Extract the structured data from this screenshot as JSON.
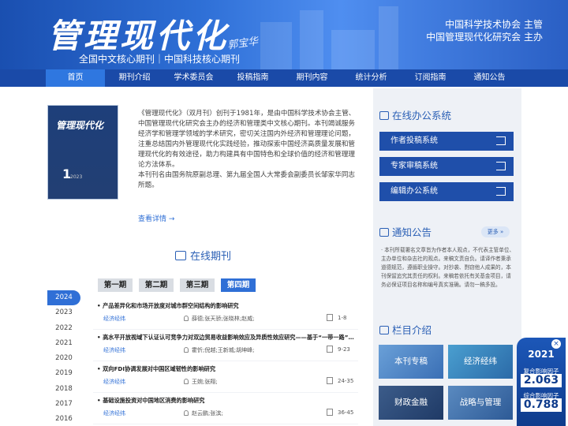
{
  "header": {
    "title": "管理现代化",
    "signature": "郭宝华",
    "subtitle": "全国中文核心期刊｜中国科技核心期刊",
    "org_line1": "中国科学技术协会 主管",
    "org_line2": "中国管理现代化研究会 主办"
  },
  "nav": {
    "items": [
      {
        "label": "首页"
      },
      {
        "label": "期刊介绍"
      },
      {
        "label": "学术委员会"
      },
      {
        "label": "投稿指南"
      },
      {
        "label": "期刊内容"
      },
      {
        "label": "统计分析"
      },
      {
        "label": "订阅指南"
      },
      {
        "label": "通知公告"
      }
    ],
    "active_index": 0
  },
  "cover": {
    "title": "管理现代化",
    "issue": "1",
    "year": "2023"
  },
  "intro": {
    "paragraph1": "《管理现代化》（双月刊）创刊于1981年，是由中国科学技术协会主管、中国管理现代化研究会主办的经济和管理类中文核心期刊。本刊竭诚服务经济学和管理学领域的学术研究，密切关注国内外经济和管理理论问题，注重总结国内外管理现代化实践经验，推动探索中国经济高质量发展和管理现代化的有效途径，助力构建具有中国特色和全球价值的经济和管理理论方法体系。",
    "paragraph2": "本刊刊名由国务院原副总理、第九届全国人大常委会副委员长邹家华同志所题。",
    "more_link": "查看详情 →"
  },
  "online": {
    "title": "在线期刊",
    "tabs": [
      "第一期",
      "第二期",
      "第三期",
      "第四期"
    ],
    "active_tab": 3,
    "years": [
      "2024",
      "2023",
      "2022",
      "2021",
      "2020",
      "2019",
      "2018",
      "2017",
      "2016"
    ],
    "active_year": 0,
    "articles": [
      {
        "title": "产品差异化和市场开放度对城市群空间结构的影响研究",
        "category": "经济经纬",
        "authors": "薛德;张天骄;张晓林;赵威;",
        "pages": "1-8"
      },
      {
        "title": "高水平开放视域下认证认可竞争力对双边贸易收益影响效应及异质性效应研究——基于“一带一路”沿...",
        "category": "经济经纬",
        "authors": "霍忻;倪越;王新城;胡坤峰;",
        "pages": "9-23"
      },
      {
        "title": "双向FDI协调发展对中国区域韧性的影响研究",
        "category": "经济经纬",
        "authors": "王婉;张翔;",
        "pages": "24-35"
      },
      {
        "title": "基础设施投资对中国地区消费的影响研究",
        "category": "经济经纬",
        "authors": "赵云鹏;张滨;",
        "pages": "36-45"
      }
    ]
  },
  "office": {
    "title": "在线办公系统",
    "buttons": [
      "作者投稿系统",
      "专家审稿系统",
      "编辑办公系统"
    ]
  },
  "notice": {
    "title": "通知公告",
    "more": "更多 »",
    "text": "· 本刊所载署名文章皆为作者本人观点，不代表主管单位、主办单位和杂志社的观点。来稿文责自负。请译作者秉承道德规范，遵循职业操守。对抄袭、剽窃他人成果的，本刊保留追究其责任的权利。来稿若依托有关基金项目，请务必保证项目名称和编号真实准确。请勿一稿多投。"
  },
  "columns": {
    "title": "栏目介绍",
    "cards": [
      "本刊专稿",
      "经济经纬",
      "财政金融",
      "战略与管理"
    ]
  },
  "badge": {
    "close": "×",
    "year": "2021",
    "label1": "复合影响因子",
    "value1": "2.063",
    "label2": "综合影响因子",
    "value2": "0.788"
  },
  "colors": {
    "primary": "#1f4faa",
    "accent": "#2f6fd6",
    "nav_bg": "#1a4aa8",
    "panel_bg": "#eef1f6"
  }
}
